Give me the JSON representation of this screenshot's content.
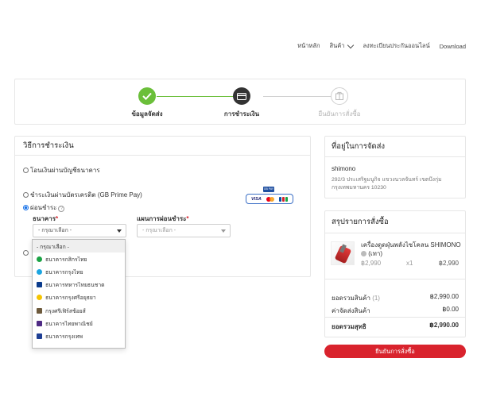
{
  "nav": {
    "items": [
      "หน้าหลัก",
      "สินค้า",
      "ลงทะเบียนประกันออนไลน์",
      "Download"
    ]
  },
  "stepper": {
    "steps": [
      {
        "label": "ข้อมูลจัดส่ง",
        "state": "done"
      },
      {
        "label": "การชำระเงิน",
        "state": "current"
      },
      {
        "label": "ยืนยันการสั่งซื้อ",
        "state": "upcoming"
      }
    ]
  },
  "payment": {
    "title": "วิธีการชำระเงิน",
    "option_bank_transfer": "โอนเงินผ่านบัญชีธนาคาร",
    "option_credit_card": "ชำระเงินผ่านบัตรเครดิต (GB Prime Pay)",
    "option_installment": "ผ่อนชำระ",
    "selected_option": "installment",
    "card_brands": [
      "VISA",
      "Mastercard",
      "JCB"
    ],
    "gb_badge": "GB PAY",
    "bank_label": "ธนาคาร",
    "bank_value": "- กรุณาเลือก -",
    "plan_label": "แผนการผ่อนชำระ",
    "plan_value": "- กรุณาเลือก -",
    "bank_options": [
      {
        "label": "- กรุณาเลือก -",
        "color": "",
        "selected": true
      },
      {
        "label": "ธนาคารกสิกรไทย",
        "color": "#1ba345"
      },
      {
        "label": "ธนาคารกรุงไทย",
        "color": "#1ba5e1"
      },
      {
        "label": "ธนาคารทหารไทยธนชาต",
        "color": "#0a3b8c"
      },
      {
        "label": "ธนาคารกรุงศรีอยุธยา",
        "color": "#f5c400"
      },
      {
        "label": "กรุงศรีเฟิร์สช้อยส์",
        "color": "#6d5a3c"
      },
      {
        "label": "ธนาคารไทยพาณิชย์",
        "color": "#4e2a84"
      },
      {
        "label": "ธนาคารกรุงเทพ",
        "color": "#1e3f94"
      }
    ]
  },
  "address": {
    "title": "ที่อยู่ในการจัดส่ง",
    "name": "shimono",
    "line1": "292/3 ประเสริฐมนูกิจ แขวงนวลจันทร์ เขตบึงกุ่ม",
    "line2": "กรุงเทพมหานคร 10230"
  },
  "summary": {
    "title": "สรุปรายการสั่งซื้อ",
    "product_name": "เครื่องดูดฝุ่นพลังไซโคลน SHIMONO",
    "product_variant": "(เทา)",
    "unit_price": "฿2,990",
    "qty": "x1",
    "line_total": "฿2,990",
    "subtotal_label": "ยอดรวมสินค้า",
    "subtotal_count": "(1)",
    "subtotal_value": "฿2,990.00",
    "shipping_label": "ค่าจัดส่งสินค้า",
    "shipping_value": "฿0.00",
    "net_label": "ยอดรวมสุทธิ",
    "net_value": "฿2,990.00"
  },
  "confirm_button": "ยืนยันการสั่งซื้อ",
  "colors": {
    "accent_red": "#d9232d",
    "step_done": "#6bbf3a",
    "step_current": "#333333"
  }
}
